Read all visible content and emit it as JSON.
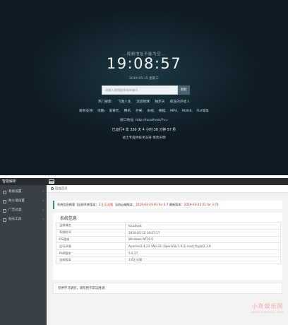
{
  "hero": {
    "tagline": "…视频地址不能为空…",
    "clock": "19:08:57",
    "date": "2019-05-15 星期三",
    "search_placeholder": "请输入视频链接或关键词",
    "search_button": "解析",
    "row1": [
      "热门搜索:",
      "飞驰人生",
      "流浪地球",
      "独步天",
      "疯狂的外星人"
    ],
    "row2": [
      "解析支持:",
      "优酷,",
      "爱奇艺,",
      "腾讯,",
      "芒果,",
      "乐视,",
      "搜狐,",
      "MP4,",
      "M3U8,",
      "FLV等等"
    ],
    "api": "接口地址: http://localhost/?v=",
    "uptime": "已运行4 年 359 天 4 小时 38 分钟 57 秒",
    "credit": "站士专提供技术支持  免责声明"
  },
  "topbar": {
    "brand": "智能解析"
  },
  "sidebar": {
    "items": [
      {
        "label": "系统设置"
      },
      {
        "label": "防火墙设置"
      },
      {
        "label": "广告过滤"
      },
      {
        "label": "站长工具"
      }
    ]
  },
  "main": {
    "tab": "后台首页",
    "notice": {
      "prefix": "系统信息概要【当前系统版本：",
      "version": "3.6 正式版",
      "mid1": "当前云端版本：",
      "cloud": "2019-03-23-01 for 3.7",
      "mid2": "  最新版本：",
      "latest": "2019-03-23-01 for 3.7",
      "suffix": "】"
    },
    "sysinfo": {
      "title": "系统信息",
      "rows": [
        {
          "k": "当前域名",
          "v": "localhost"
        },
        {
          "k": "系统时间",
          "v": "2019-05-15 19:07:17"
        },
        {
          "k": "OS版本",
          "v": "Windows NT10.0"
        },
        {
          "k": "运行环境",
          "v": "Apache/2.4.23 (Win32) OpenSSL/1.0.2j mod_fcgid/2.3.9"
        },
        {
          "k": "PHP版本",
          "v": "5.6.27"
        },
        {
          "k": "当前版本",
          "v": "3.6正式版"
        }
      ]
    },
    "footnote": "仅供学习研究，请勿用于非法用途!"
  },
  "watermark": {
    "line1": "小灰娱乐网",
    "line2": "www.xiaohuyl.com"
  },
  "colors": {
    "hero_bg": "#0c1a22",
    "sidebar_bg": "#3a4146",
    "topbar_bg": "#262c30",
    "accent_teal": "#1a9e86",
    "version_red": "#d9261c"
  }
}
